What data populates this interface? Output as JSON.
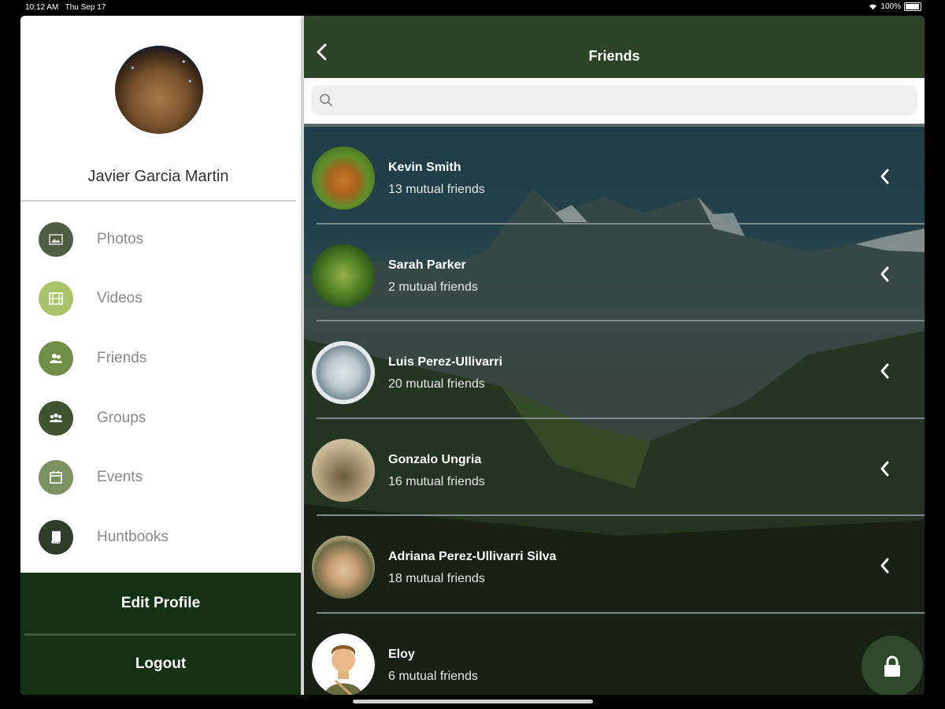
{
  "status": {
    "time": "10:12 AM",
    "date": "Thu Sep 17",
    "battery": "100%"
  },
  "profile": {
    "name": "Javier Garcia Martin"
  },
  "menu": [
    {
      "label": "Photos",
      "icon": "photo-icon",
      "color": "#4f5d43"
    },
    {
      "label": "Videos",
      "icon": "film-icon",
      "color": "#a7c46b"
    },
    {
      "label": "Friends",
      "icon": "friends-icon",
      "color": "#6f8f46"
    },
    {
      "label": "Groups",
      "icon": "groups-icon",
      "color": "#3e5431"
    },
    {
      "label": "Events",
      "icon": "calendar-icon",
      "color": "#7b9362"
    },
    {
      "label": "Huntbooks",
      "icon": "book-icon",
      "color": "#2f3d29"
    }
  ],
  "buttons": {
    "edit_profile": "Edit Profile",
    "logout": "Logout"
  },
  "header": {
    "title": "Friends"
  },
  "search": {
    "placeholder": ""
  },
  "friends": [
    {
      "name": "Kevin Smith",
      "mutual": "13 mutual friends"
    },
    {
      "name": "Sarah Parker",
      "mutual": "2 mutual friends"
    },
    {
      "name": "Luis Perez-Ullivarri",
      "mutual": "20 mutual friends"
    },
    {
      "name": "Gonzalo Ungria",
      "mutual": "16 mutual friends"
    },
    {
      "name": "Adriana Perez-Ullivarri Silva",
      "mutual": "18 mutual friends"
    },
    {
      "name": "Eloy",
      "mutual": "6 mutual friends"
    }
  ],
  "colors": {
    "brand_dark": "#143013",
    "header": "#2d4326",
    "accent": "#6f8f46"
  }
}
